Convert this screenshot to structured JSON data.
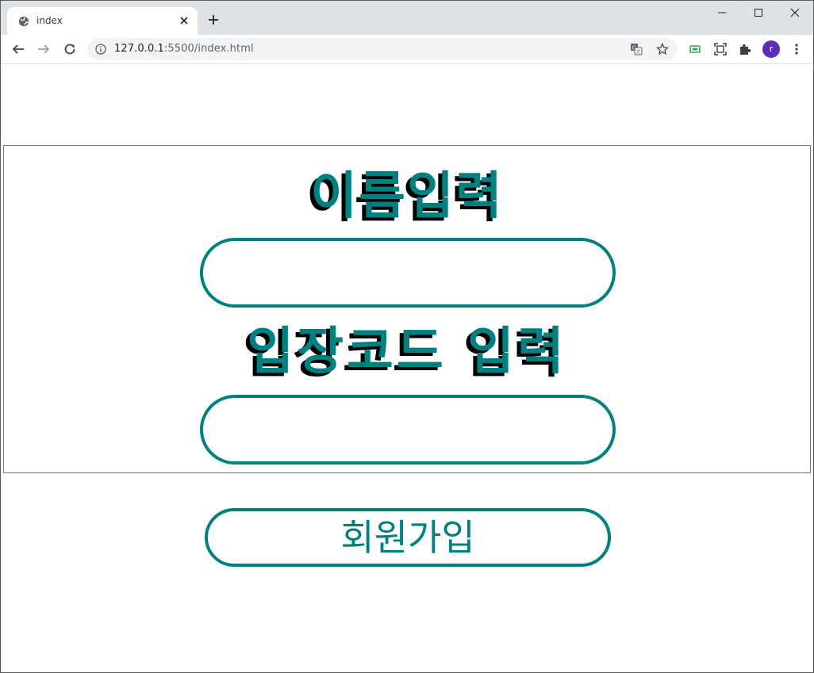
{
  "browser": {
    "tab": {
      "title": "index",
      "favicon_icon": "globe-icon",
      "close_icon": "close-icon"
    },
    "new_tab_icon": "plus-icon",
    "window_controls": [
      "minimize-icon",
      "maximize-icon",
      "close-icon"
    ],
    "toolbar": {
      "back_icon": "arrow-left-icon",
      "forward_icon": "arrow-right-icon",
      "reload_icon": "reload-icon",
      "url_host": "127.0.0.1",
      "url_rest": ":5500/index.html",
      "info_icon": "info-icon",
      "translate_icon": "translate-icon",
      "bookmark_icon": "star-icon",
      "extensions": [
        "screen-share-icon",
        "screenshot-icon",
        "puzzle-icon"
      ],
      "profile_initial": "r",
      "menu_icon": "kebab-menu-icon"
    }
  },
  "page": {
    "name_label": "이름입력",
    "name_value": "",
    "code_label": "입장코드 입력",
    "code_value": "",
    "signup_button_label": "회원가입"
  },
  "colors": {
    "accent": "#008080",
    "shadow": "#000000",
    "avatar": "#5b2fb5"
  }
}
